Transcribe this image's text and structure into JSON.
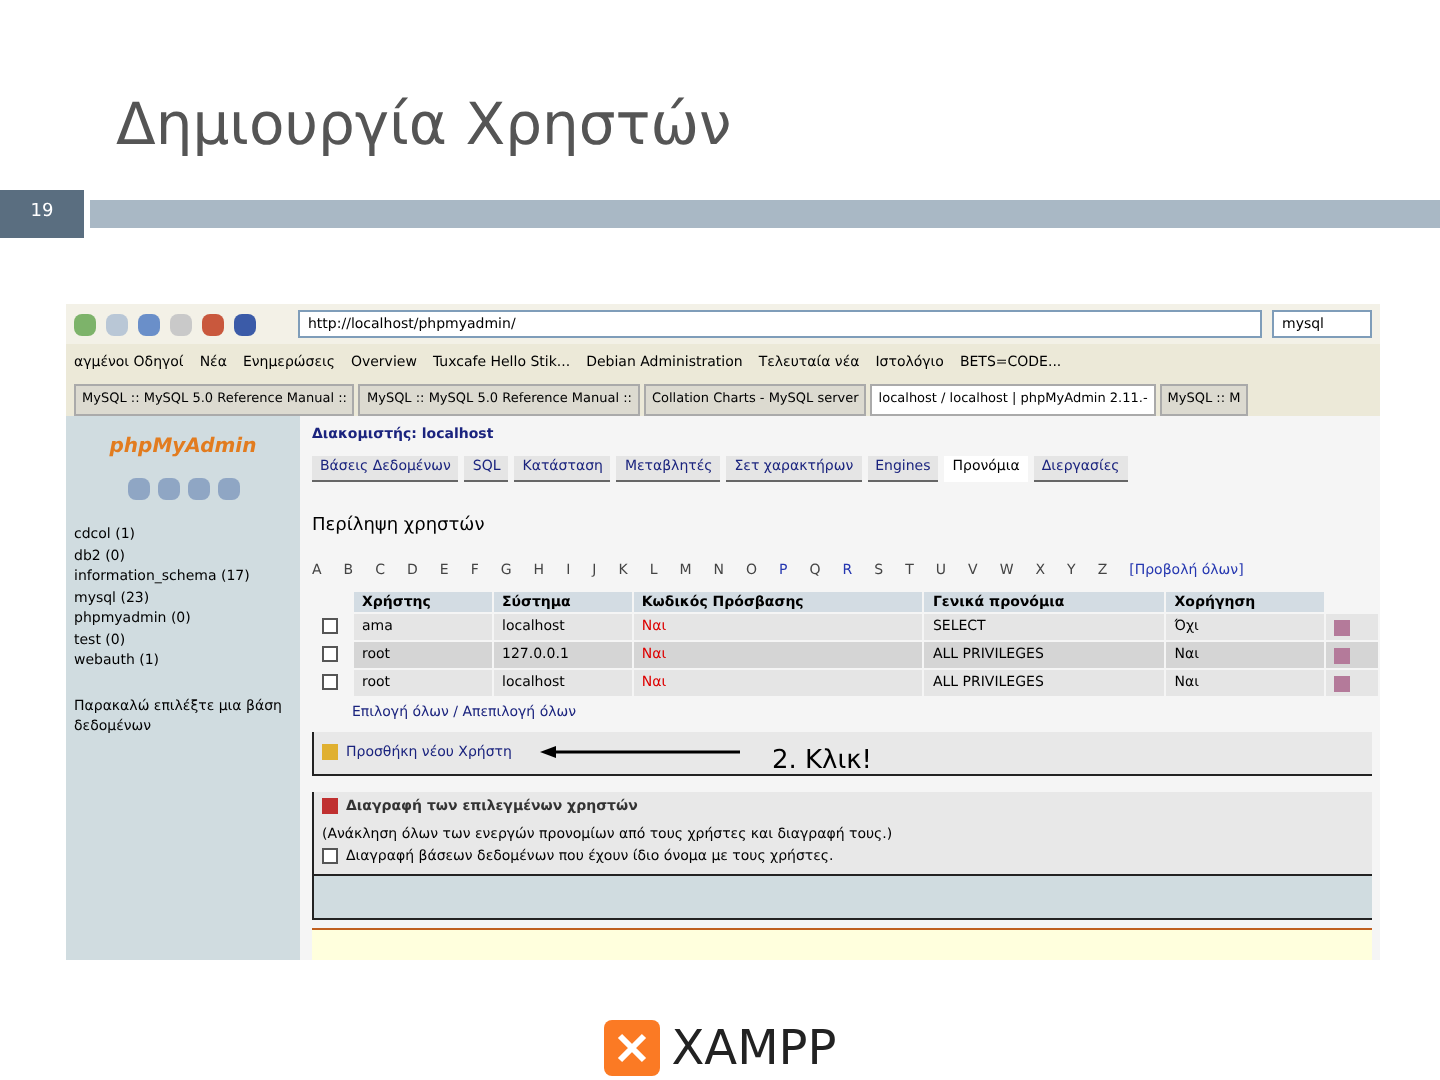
{
  "slide": {
    "title": "Δημιουργία Χρηστών",
    "page_number": "19"
  },
  "browser": {
    "url": "http://localhost/phpmyadmin/",
    "search": "mysql",
    "bookmarks": [
      "αγμένοι Οδηγοί",
      "Νέα",
      "Ενημερώσεις",
      "Overview",
      "Tuxcafe Hello Stik...",
      "Debian Administration",
      "Τελευταία νέα",
      "Ιστολόγιο",
      "BETS=CODE..."
    ],
    "tabs": [
      {
        "label": "MySQL :: MySQL 5.0 Reference Manual ::",
        "selected": false
      },
      {
        "label": "MySQL :: MySQL 5.0 Reference Manual ::",
        "selected": false
      },
      {
        "label": "Collation Charts - MySQL server",
        "selected": false
      },
      {
        "label": "localhost / localhost | phpMyAdmin 2.11.-",
        "selected": true
      },
      {
        "label": "MySQL :: M",
        "selected": false
      }
    ]
  },
  "pma": {
    "logo": "phpMyAdmin",
    "databases": [
      "cdcol (1)",
      "db2 (0)",
      "information_schema (17)",
      "mysql (23)",
      "phpmyadmin (0)",
      "test (0)",
      "webauth (1)"
    ],
    "sidebar_note": "Παρακαλώ επιλέξτε μια βάση δεδομένων",
    "server": "Διακομιστής: localhost",
    "tabs": [
      {
        "label": "Βάσεις Δεδομένων",
        "selected": false
      },
      {
        "label": "SQL",
        "selected": false
      },
      {
        "label": "Κατάσταση",
        "selected": false
      },
      {
        "label": "Μεταβλητές",
        "selected": false
      },
      {
        "label": "Σετ χαρακτήρων",
        "selected": false
      },
      {
        "label": "Engines",
        "selected": false
      },
      {
        "label": "Προνόμια",
        "selected": true
      },
      {
        "label": "Διεργασίες",
        "selected": false
      }
    ],
    "heading": "Περίληψη χρηστών",
    "letters": [
      {
        "label": "A",
        "linked": false
      },
      {
        "label": "B",
        "linked": false
      },
      {
        "label": "C",
        "linked": false
      },
      {
        "label": "D",
        "linked": false
      },
      {
        "label": "E",
        "linked": false
      },
      {
        "label": "F",
        "linked": false
      },
      {
        "label": "G",
        "linked": false
      },
      {
        "label": "H",
        "linked": false
      },
      {
        "label": "I",
        "linked": false
      },
      {
        "label": "J",
        "linked": false
      },
      {
        "label": "K",
        "linked": false
      },
      {
        "label": "L",
        "linked": false
      },
      {
        "label": "M",
        "linked": false
      },
      {
        "label": "N",
        "linked": false
      },
      {
        "label": "O",
        "linked": false
      },
      {
        "label": "P",
        "linked": true
      },
      {
        "label": "Q",
        "linked": false
      },
      {
        "label": "R",
        "linked": true
      },
      {
        "label": "S",
        "linked": false
      },
      {
        "label": "T",
        "linked": false
      },
      {
        "label": "U",
        "linked": false
      },
      {
        "label": "V",
        "linked": false
      },
      {
        "label": "W",
        "linked": false
      },
      {
        "label": "X",
        "linked": false
      },
      {
        "label": "Y",
        "linked": false
      },
      {
        "label": "Z",
        "linked": false
      },
      {
        "label": "[Προβολή όλων]",
        "linked": true
      }
    ],
    "table": {
      "columns": [
        "Χρήστης",
        "Σύστημα",
        "Κωδικός Πρόσβασης",
        "Γενικά προνόμια",
        "Χορήγηση"
      ],
      "rows": [
        {
          "checked": false,
          "cells": [
            "ama",
            "localhost",
            "Ναι",
            "SELECT",
            "Όχι"
          ]
        },
        {
          "checked": false,
          "cells": [
            "root",
            "127.0.0.1",
            "Ναι",
            "ALL PRIVILEGES",
            "Ναι"
          ]
        },
        {
          "checked": false,
          "cells": [
            "root",
            "localhost",
            "Ναι",
            "ALL PRIVILEGES",
            "Ναι"
          ]
        }
      ]
    },
    "check_all": "Επιλογή όλων / Απεπιλογή όλων",
    "add_user": "Προσθήκη νέου Χρήστη",
    "annotation": "2. Κλικ!",
    "delete_title": "Διαγραφή των επιλεγμένων χρηστών",
    "delete_note": "(Ανάκληση όλων των ενεργών προνομίων από τους χρήστες και διαγραφή τους.)",
    "delete_option": {
      "label": "Διαγραφή βάσεων δεδομένων που έχουν ίδιο όνομα με τους χρήστες.",
      "checked": false
    }
  },
  "footer_logo": "XAMPP"
}
